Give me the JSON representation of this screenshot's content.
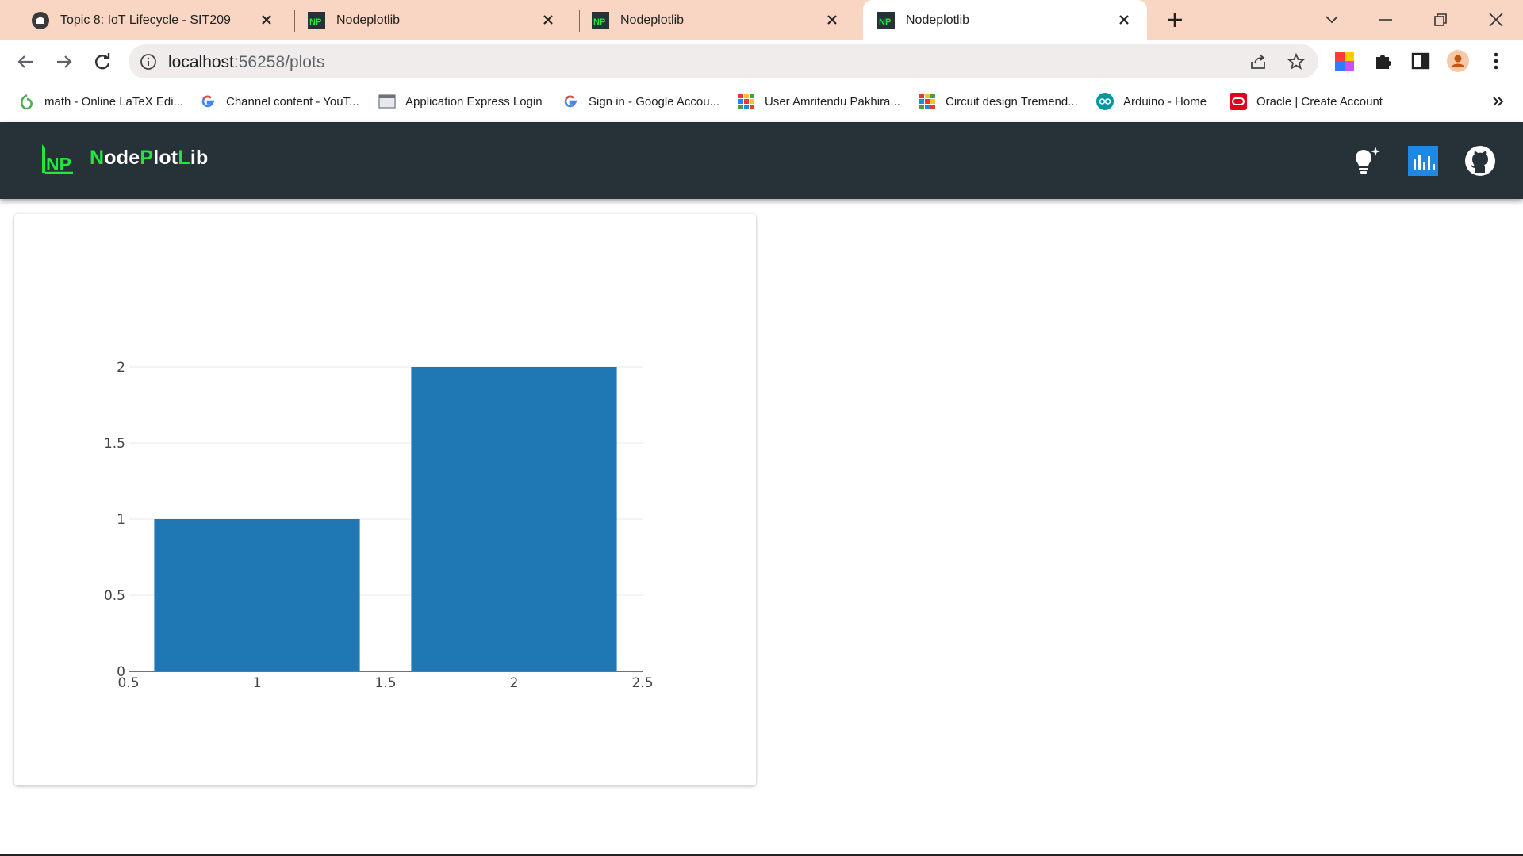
{
  "browser": {
    "tabs": [
      {
        "title": "Topic 8: IoT Lifecycle - SIT209",
        "active": false
      },
      {
        "title": "Nodeplotlib",
        "active": false
      },
      {
        "title": "Nodeplotlib",
        "active": false
      },
      {
        "title": "Nodeplotlib",
        "active": true
      }
    ],
    "url_host": "localhost",
    "url_path": ":56258/plots",
    "bookmarks": [
      {
        "label": "math - Online LaTeX Edi...",
        "icon": "overleaf-icon"
      },
      {
        "label": "Channel content - YouT...",
        "icon": "google-icon"
      },
      {
        "label": "Application Express Login",
        "icon": "page-icon"
      },
      {
        "label": "Sign in - Google Accou...",
        "icon": "google-icon"
      },
      {
        "label": "User Amritendu Pakhira...",
        "icon": "tinkercad-icon"
      },
      {
        "label": "Circuit design Tremend...",
        "icon": "tinkercad-icon"
      },
      {
        "label": "Arduino - Home",
        "icon": "arduino-icon"
      },
      {
        "label": "Oracle | Create Account",
        "icon": "oracle-icon"
      }
    ]
  },
  "app": {
    "brand_parts": [
      {
        "text": "N",
        "accent": true
      },
      {
        "text": "ode",
        "accent": false
      },
      {
        "text": "P",
        "accent": true
      },
      {
        "text": "lot",
        "accent": false
      },
      {
        "text": "L",
        "accent": true
      },
      {
        "text": "ib",
        "accent": false
      }
    ],
    "logo_text": "NP",
    "colors": {
      "header_bg": "#263238",
      "accent": "#22e63c",
      "bar": "#1f77b4",
      "tab_strip": "#f9d6c3"
    },
    "header_icons": [
      "theme-bulb-icon",
      "plots-chart-icon",
      "github-icon"
    ]
  },
  "chart_data": {
    "type": "bar",
    "x": [
      1,
      2
    ],
    "values": [
      1,
      2
    ],
    "xlim": [
      0.5,
      2.5
    ],
    "ylim": [
      0,
      2
    ],
    "xticks": [
      "0.5",
      "1",
      "1.5",
      "2",
      "2.5"
    ],
    "yticks": [
      "0",
      "0.5",
      "1",
      "1.5",
      "2"
    ],
    "grid": true,
    "color": "#1f77b4"
  }
}
